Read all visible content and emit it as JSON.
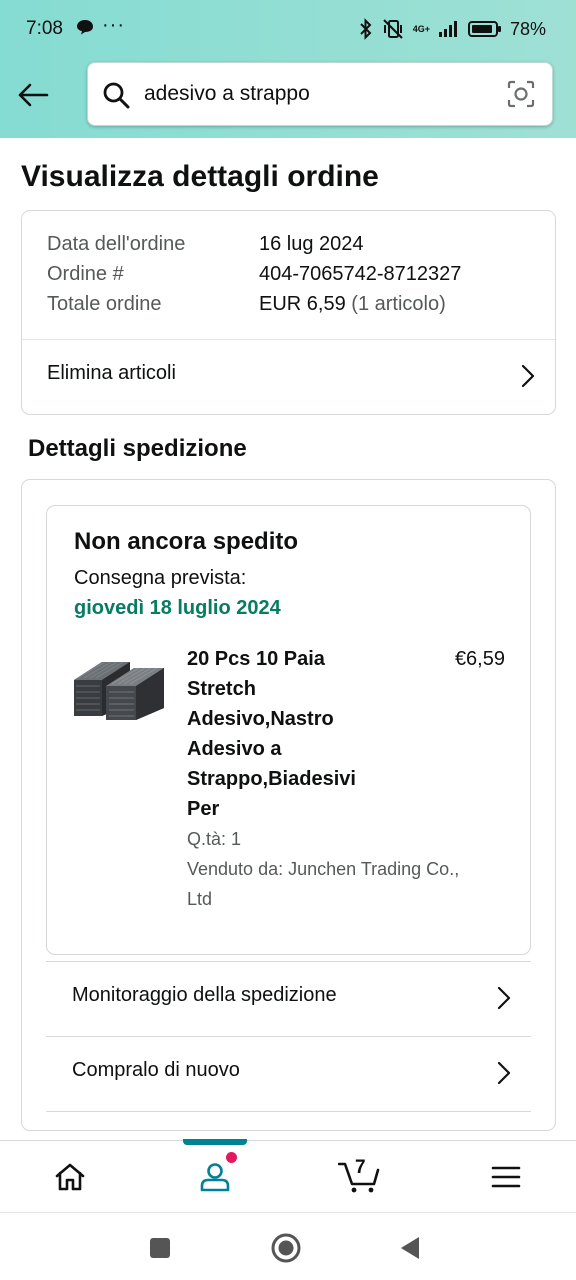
{
  "status_bar": {
    "time": "7:08",
    "more": "···",
    "network": "4G+",
    "battery_percent": "78%"
  },
  "search": {
    "query": "adesivo a strappo"
  },
  "page": {
    "title": "Visualizza dettagli ordine"
  },
  "order_summary": {
    "rows": [
      {
        "label": "Data dell'ordine",
        "value": "16 lug 2024"
      },
      {
        "label": "Ordine #",
        "value": "404-7065742-8712327"
      },
      {
        "label": "Totale ordine",
        "value": "EUR 6,59",
        "extra": "(1 articolo)"
      }
    ],
    "remove_items_label": "Elimina articoli"
  },
  "shipment": {
    "section_title": "Dettagli spedizione",
    "status": "Non ancora spedito",
    "eta_label": "Consegna prevista:",
    "eta_date": "giovedì 18 luglio 2024",
    "product": {
      "title_lines": [
        "20 Pcs 10 Paia",
        "Stretch",
        "Adesivo,Nastro",
        "Adesivo a",
        "Strappo,Biadesivi",
        "Per"
      ],
      "price": "€6,59",
      "quantity": "Q.tà: 1",
      "seller_lines": [
        "Venduto da: Junchen Trading Co.,",
        "Ltd"
      ]
    },
    "actions": [
      {
        "label": "Monitoraggio della spedizione"
      },
      {
        "label": "Compralo di nuovo"
      }
    ]
  },
  "bottom_nav": {
    "items": [
      {
        "icon": "home-icon"
      },
      {
        "icon": "account-icon",
        "active": true
      },
      {
        "icon": "cart-icon",
        "count": "7"
      },
      {
        "icon": "menu-icon"
      }
    ]
  },
  "colors": {
    "header_gradient_start": "#85dcd2",
    "header_gradient_end": "#9fe0d5",
    "delivery_green": "#067d62",
    "nav_active": "#008296",
    "notification_dot": "#e3195f"
  }
}
